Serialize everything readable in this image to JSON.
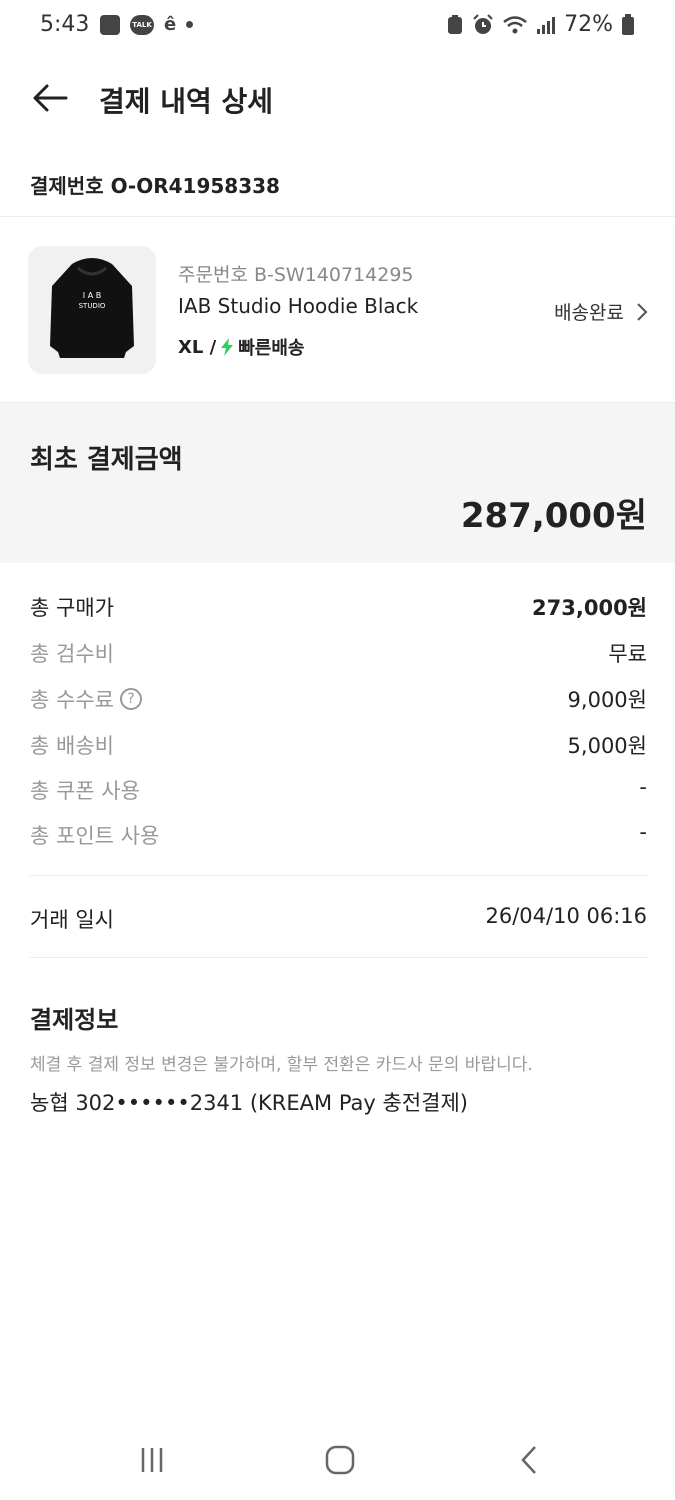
{
  "status_bar": {
    "time": "5:43",
    "talk_label": "TALK",
    "battery_percent": "72%"
  },
  "header": {
    "title": "결제 내역 상세"
  },
  "payment_number": "결제번호 O-OR41958338",
  "order": {
    "order_number": "주문번호 B-SW140714295",
    "product_name": "IAB Studio Hoodie Black",
    "size": "XL /",
    "shipping_type": "빠른배송",
    "status": "배송완료",
    "thumbnail_text_top": "I A B",
    "thumbnail_text_bottom": "STUDIO"
  },
  "summary": {
    "label": "최초 결제금액",
    "amount": "287,000원"
  },
  "breakdown": [
    {
      "label": "총 구매가",
      "value": "273,000원"
    },
    {
      "label": "총 검수비",
      "value": "무료"
    },
    {
      "label": "총 수수료",
      "value": "9,000원"
    },
    {
      "label": "총 배송비",
      "value": "5,000원"
    },
    {
      "label": "총 쿠폰 사용",
      "value": "-"
    },
    {
      "label": "총 포인트 사용",
      "value": "-"
    }
  ],
  "transaction": {
    "label": "거래 일시",
    "value": "26/04/10 06:16"
  },
  "payment_info": {
    "title": "결제정보",
    "note": "체결 후 결제 정보 변경은 불가하며, 할부 전환은 카드사 문의 바랍니다.",
    "method": "농협 302••••••2341 (KREAM Pay 충전결제)"
  },
  "colors": {
    "accent_green": "#2bd15c",
    "summary_bg": "#f5f5f5",
    "muted_text": "#999999"
  }
}
